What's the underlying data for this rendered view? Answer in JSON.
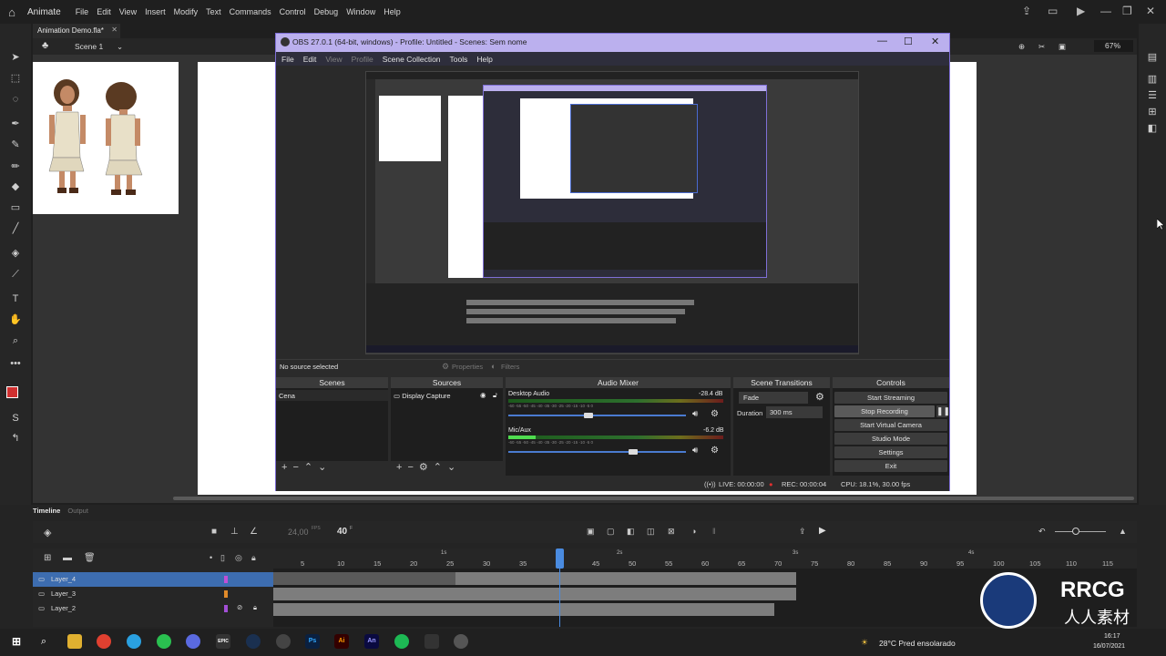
{
  "animate": {
    "app_name": "Animate",
    "menu": [
      "File",
      "Edit",
      "View",
      "Insert",
      "Modify",
      "Text",
      "Commands",
      "Control",
      "Debug",
      "Window",
      "Help"
    ],
    "doc_tab": "Animation Demo.fla*",
    "scene": "Scene 1",
    "zoom": "67%"
  },
  "obs": {
    "title": "OBS 27.0.1 (64-bit, windows) - Profile: Untitled - Scenes: Sem nome",
    "menu": [
      "File",
      "Edit",
      "View",
      "Profile",
      "Scene Collection",
      "Tools",
      "Help"
    ],
    "source_bar": {
      "no_source": "No source selected",
      "properties": "Properties",
      "filters": "Filters"
    },
    "panels": {
      "scenes": {
        "title": "Scenes",
        "items": [
          "Cena"
        ]
      },
      "sources": {
        "title": "Sources",
        "items": [
          "Display Capture"
        ]
      },
      "mixer": {
        "title": "Audio Mixer",
        "channels": [
          {
            "name": "Desktop Audio",
            "db": "-28.4 dB",
            "level": 0.45
          },
          {
            "name": "Mic/Aux",
            "db": "-6.2 dB",
            "level": 0.7
          }
        ],
        "scale": "-60 -55 -50 -45 -40 -35 -30 -25 -20 -15 -10 -5 0"
      },
      "transitions": {
        "title": "Scene Transitions",
        "type": "Fade",
        "duration_label": "Duration",
        "duration": "300 ms"
      },
      "controls": {
        "title": "Controls",
        "buttons": [
          "Start Streaming",
          "Stop Recording",
          "Start Virtual Camera",
          "Studio Mode",
          "Settings",
          "Exit"
        ]
      }
    },
    "status": {
      "live": "LIVE: 00:00:00",
      "rec": "REC: 00:00:04",
      "cpu": "CPU: 18.1%, 30.00 fps"
    }
  },
  "timeline": {
    "tabs": [
      "Timeline",
      "Output"
    ],
    "fps": "24,00",
    "fps_unit": "FPS",
    "frame": "40",
    "frame_unit": "F",
    "layers": [
      "Layer_4",
      "Layer_3",
      "Layer_2"
    ],
    "layer_colors": [
      "#c04fd6",
      "#e08a2a",
      "#a24fd6"
    ],
    "ruler_marks": [
      "5",
      "10",
      "15",
      "20",
      "25",
      "30",
      "35",
      "40",
      "45",
      "50",
      "55",
      "60",
      "65",
      "70",
      "75",
      "80",
      "85",
      "90",
      "95",
      "100",
      "105",
      "110",
      "115"
    ],
    "second_marks": [
      "1s",
      "2s",
      "3s",
      "4s"
    ]
  },
  "taskbar": {
    "weather": "28°C  Pred ensolarado",
    "time": "16:17",
    "date": "16/07/2021",
    "apps": [
      "explorer",
      "chrome",
      "telegram",
      "whatsapp",
      "discord",
      "epic",
      "steam",
      "obs-cam",
      "photoshop",
      "illustrator",
      "animate",
      "spotify",
      "pin",
      "obs"
    ]
  },
  "watermark": {
    "brand": "RRCG",
    "sub": "人人素材"
  }
}
